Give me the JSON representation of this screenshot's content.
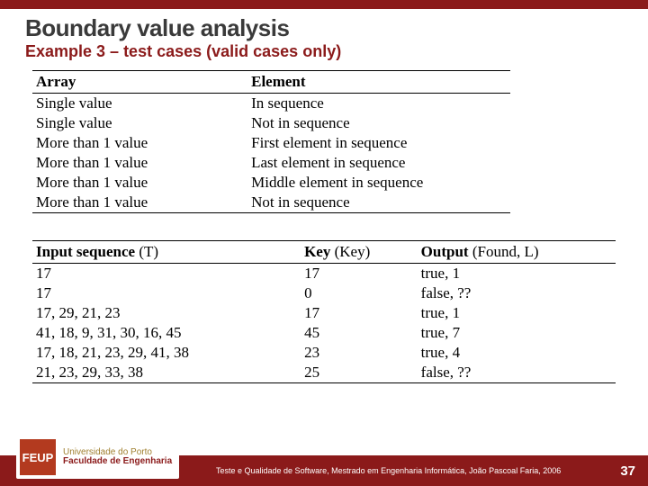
{
  "header": {
    "title": "Boundary value analysis",
    "subtitle": "Example 3 – test cases (valid cases only)"
  },
  "table1": {
    "headers": {
      "c1": "Array",
      "c2": "Element"
    },
    "rows": [
      {
        "c1": "Single value",
        "c2": "In sequence"
      },
      {
        "c1": "Single value",
        "c2": "Not in sequence"
      },
      {
        "c1": "More than 1 value",
        "c2": "First element in sequence"
      },
      {
        "c1": "More than 1 value",
        "c2": "Last element in sequence"
      },
      {
        "c1": "More than 1 value",
        "c2": "Middle element in sequence"
      },
      {
        "c1": "More than 1 value",
        "c2": "Not in sequence"
      }
    ]
  },
  "table2": {
    "headers": {
      "c1b": "Input sequence",
      "c1p": " (T)",
      "c2b": "Key",
      "c2p": " (Key)",
      "c3b": "Output",
      "c3p": " (Found, L)"
    },
    "rows": [
      {
        "c1": "17",
        "c2": "17",
        "c3": "true, 1"
      },
      {
        "c1": "17",
        "c2": "0",
        "c3": "false, ??"
      },
      {
        "c1": "17, 29, 21, 23",
        "c2": "17",
        "c3": "true, 1"
      },
      {
        "c1": "41, 18, 9, 31, 30, 16, 45",
        "c2": "45",
        "c3": "true, 7"
      },
      {
        "c1": "17, 18, 21, 23, 29, 41, 38",
        "c2": "23",
        "c3": "true, 4"
      },
      {
        "c1": "21, 23, 29, 33, 38",
        "c2": "25",
        "c3": "false, ??"
      }
    ]
  },
  "footer": {
    "logo_badge": "FEUP",
    "logo_line1": "Universidade do Porto",
    "logo_line2": "Faculdade de Engenharia",
    "text": "Teste e Qualidade de Software, Mestrado em Engenharia Informática, João Pascoal Faria, 2006",
    "page": "37"
  }
}
